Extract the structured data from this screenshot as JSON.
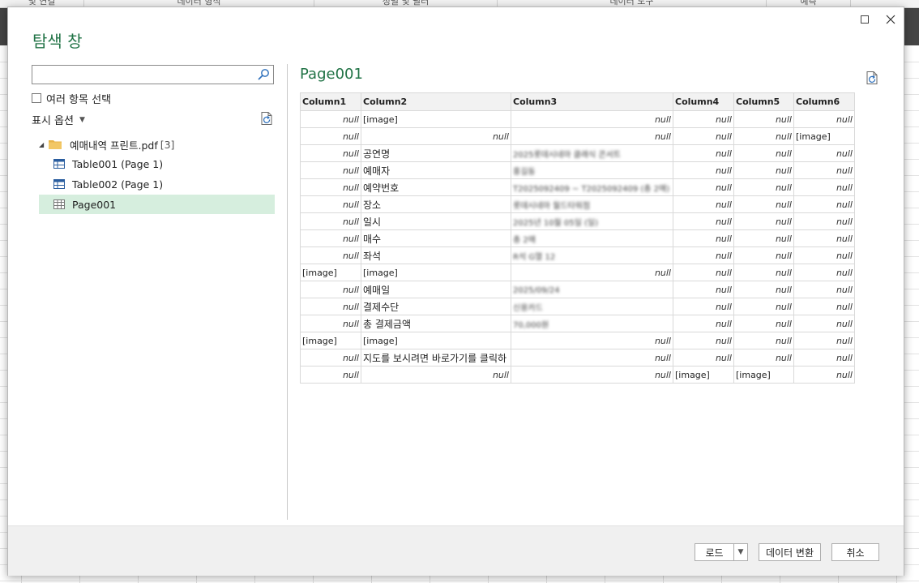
{
  "background": {
    "ribbon_groups": [
      "및 연결",
      "데이터 형식",
      "정렬 및 필터",
      "데이터 도구",
      "예측"
    ]
  },
  "dialog": {
    "title": "탐색 창",
    "search": {
      "value": "",
      "placeholder": ""
    },
    "multi_select_label": "여러 항목 선택",
    "display_options_label": "표시 옵션",
    "tree": {
      "folder_name": "예매내역 프린트.pdf",
      "folder_count": "[3]",
      "items": [
        "Table001 (Page 1)",
        "Table002 (Page 1)",
        "Page001"
      ],
      "selected": "Page001"
    },
    "preview": {
      "title": "Page001",
      "columns": [
        "Column1",
        "Column2",
        "Column3",
        "Column4",
        "Column5",
        "Column6"
      ],
      "rows": [
        [
          "null",
          "[image]",
          "null",
          "null",
          "null",
          "null"
        ],
        [
          "null",
          "null",
          "null",
          "null",
          "null",
          "[image]"
        ],
        [
          "null",
          "공연명",
          "2025롯데시네마 클래식 콘서트",
          "null",
          "null",
          "null"
        ],
        [
          "null",
          "예매자",
          "홍길동",
          "null",
          "null",
          "null"
        ],
        [
          "null",
          "예약번호",
          "T2025092409 ~ T2025092409 (총 2매)",
          "null",
          "null",
          "null"
        ],
        [
          "null",
          "장소",
          "롯데시네마 월드타워점",
          "null",
          "null",
          "null"
        ],
        [
          "null",
          "일시",
          "2025년 10월 05일 (일)",
          "null",
          "null",
          "null"
        ],
        [
          "null",
          "매수",
          "총 2매",
          "null",
          "null",
          "null"
        ],
        [
          "null",
          "좌석",
          "R석 G열 12",
          "null",
          "null",
          "null"
        ],
        [
          "[image]",
          "[image]",
          "null",
          "null",
          "null",
          "null"
        ],
        [
          "null",
          "예매일",
          "2025/09/24",
          "null",
          "null",
          "null"
        ],
        [
          "null",
          "결제수단",
          "신용카드",
          "null",
          "null",
          "null"
        ],
        [
          "null",
          "총 결제금액",
          "70,000원",
          "null",
          "null",
          "null"
        ],
        [
          "[image]",
          "[image]",
          "null",
          "null",
          "null",
          "null"
        ],
        [
          "null",
          "지도를 보시려면 바로가기를 클릭하",
          "null",
          "null",
          "null",
          "null"
        ],
        [
          "null",
          "null",
          "null",
          "[image]",
          "[image]",
          "null"
        ]
      ],
      "blurred_cells": [
        "2-2",
        "3-2",
        "4-2",
        "5-2",
        "6-2",
        "7-2",
        "8-2",
        "10-2",
        "11-2",
        "12-2"
      ]
    },
    "footer": {
      "load_label": "로드",
      "transform_label": "데이터 변환",
      "cancel_label": "취소"
    }
  },
  "colors": {
    "accent_green": "#217346",
    "selected_row": "#d6eede",
    "header_bg": "#f2f2f2"
  },
  "icons": [
    "search-icon",
    "refresh-icon",
    "folder-icon",
    "table-icon",
    "close-icon",
    "maximize-icon",
    "chevron-down-icon"
  ]
}
